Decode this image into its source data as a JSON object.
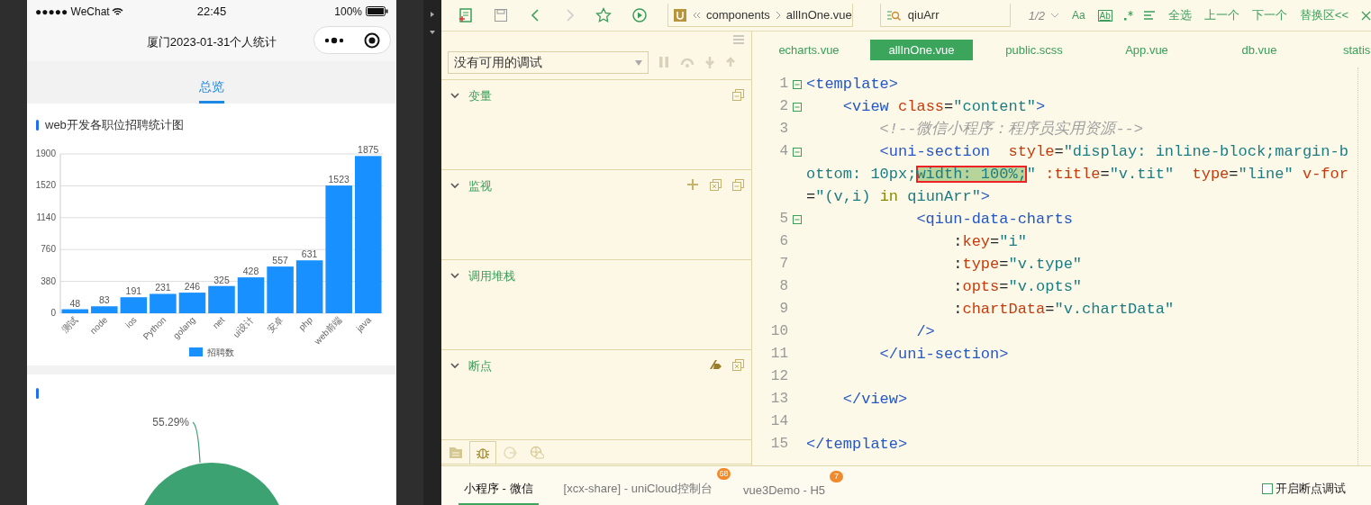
{
  "phone": {
    "status_bar": {
      "carrier": "●●●●● WeChat",
      "time": "22:45",
      "battery": "100%"
    },
    "title": "厦门2023-01-31个人统计",
    "tabs": [
      {
        "label": "总览",
        "selected": true
      }
    ],
    "sections": [
      {
        "kind": "bar",
        "title": "web开发各职位招聘统计图",
        "chart_data": {
          "type": "bar",
          "categories": [
            "测试",
            "node",
            "ios",
            "Python",
            "golang",
            "net",
            "ui设计",
            "安卓",
            "php",
            "web前端",
            "java"
          ],
          "series": [
            {
              "name": "招聘数",
              "color": "#1890ff",
              "values": [
                48,
                83,
                191,
                231,
                246,
                325,
                428,
                557,
                631,
                1523,
                1875
              ]
            }
          ],
          "ylim": [
            0,
            1900
          ],
          "yticks": [
            0,
            380,
            760,
            1140,
            1520,
            1900
          ],
          "data_labels": true,
          "grid": true
        }
      },
      {
        "kind": "pie",
        "pie_label": "55.29%"
      }
    ]
  },
  "toolbar": {
    "forward_disabled": true,
    "breadcrumb": [
      "components",
      "allInOne.vue"
    ],
    "search": {
      "value": "qiuArr",
      "count": "1/2"
    },
    "find_options": [
      "Aa",
      "Ab"
    ],
    "actions": [
      "全选",
      "上一个",
      "下一个",
      "替换区<<"
    ]
  },
  "debug": {
    "target": "没有可用的调试",
    "controls_disabled": true,
    "sections": [
      {
        "title": "变量",
        "expanded": true
      },
      {
        "title": "监视",
        "expanded": true
      },
      {
        "title": "调用堆栈",
        "expanded": true
      },
      {
        "title": "断点",
        "expanded": true
      }
    ],
    "side_tabs": [
      {
        "selected": false
      },
      {
        "selected": true
      },
      {
        "selected": false
      },
      {
        "selected": false
      }
    ]
  },
  "editor": {
    "tabs": [
      {
        "label": "echarts.vue",
        "selected": false
      },
      {
        "label": "allInOne.vue",
        "selected": true
      },
      {
        "label": "public.scss",
        "selected": false
      },
      {
        "label": "App.vue",
        "selected": false
      },
      {
        "label": "db.vue",
        "selected": false
      },
      {
        "label": "statis",
        "selected": false
      }
    ],
    "lines": [
      {
        "number": "1",
        "fold": true,
        "wraps": [
          {
            "tokens": [
              {
                "kind": "tag",
                "text": "<template>"
              }
            ]
          }
        ]
      },
      {
        "number": "2",
        "fold": true,
        "wraps": [
          {
            "tokens": [
              {
                "kind": "tag",
                "text": "    <view "
              },
              {
                "kind": "attr",
                "text": "class"
              },
              {
                "kind": "plain",
                "text": "="
              },
              {
                "kind": "string",
                "text": "\"content\""
              },
              {
                "kind": "tag",
                "text": ">"
              }
            ]
          }
        ]
      },
      {
        "number": "3",
        "fold": false,
        "wraps": [
          {
            "tokens": [
              {
                "kind": "comment",
                "text": "        <!--微信小程序：程序员实用资源-->"
              }
            ]
          }
        ]
      },
      {
        "number": "4",
        "fold": true,
        "wraps": [
          {
            "tokens": [
              {
                "kind": "tag",
                "text": "        <uni-section  "
              },
              {
                "kind": "attr",
                "text": "style"
              },
              {
                "kind": "plain",
                "text": "="
              },
              {
                "kind": "string",
                "text": "\"display: inline-block;margin-b"
              }
            ]
          },
          {
            "tokens": [
              {
                "kind": "string",
                "text": "ottom: 10px;"
              },
              {
                "kind": "selection",
                "text": "width: 100%;"
              },
              {
                "kind": "string",
                "text": "\" "
              },
              {
                "kind": "attr",
                "text": ":title"
              },
              {
                "kind": "plain",
                "text": "="
              },
              {
                "kind": "string",
                "text": "\"v.tit\"  "
              },
              {
                "kind": "attr",
                "text": "type"
              },
              {
                "kind": "plain",
                "text": "="
              },
              {
                "kind": "string",
                "text": "\"line\" "
              },
              {
                "kind": "attr",
                "text": "v-for"
              }
            ]
          },
          {
            "tokens": [
              {
                "kind": "plain",
                "text": "="
              },
              {
                "kind": "string",
                "text": "\"(v,i) "
              },
              {
                "kind": "keyword",
                "text": "in"
              },
              {
                "kind": "string",
                "text": " qiunArr\""
              },
              {
                "kind": "tag",
                "text": ">"
              }
            ]
          }
        ]
      },
      {
        "number": "5",
        "fold": true,
        "wraps": [
          {
            "tokens": [
              {
                "kind": "tag",
                "text": "            <qiun-data-charts"
              }
            ]
          }
        ]
      },
      {
        "number": "6",
        "fold": false,
        "wraps": [
          {
            "tokens": [
              {
                "kind": "plain",
                "text": "                :"
              },
              {
                "kind": "attr",
                "text": "key"
              },
              {
                "kind": "plain",
                "text": "="
              },
              {
                "kind": "string",
                "text": "\"i\""
              }
            ]
          }
        ]
      },
      {
        "number": "7",
        "fold": false,
        "wraps": [
          {
            "tokens": [
              {
                "kind": "plain",
                "text": "                :"
              },
              {
                "kind": "attr",
                "text": "type"
              },
              {
                "kind": "plain",
                "text": "="
              },
              {
                "kind": "string",
                "text": "\"v.type\""
              }
            ]
          }
        ]
      },
      {
        "number": "8",
        "fold": false,
        "wraps": [
          {
            "tokens": [
              {
                "kind": "plain",
                "text": "                :"
              },
              {
                "kind": "attr",
                "text": "opts"
              },
              {
                "kind": "plain",
                "text": "="
              },
              {
                "kind": "string",
                "text": "\"v.opts\""
              }
            ]
          }
        ]
      },
      {
        "number": "9",
        "fold": false,
        "wraps": [
          {
            "tokens": [
              {
                "kind": "plain",
                "text": "                :"
              },
              {
                "kind": "attr",
                "text": "chartData"
              },
              {
                "kind": "plain",
                "text": "="
              },
              {
                "kind": "string",
                "text": "\"v.chartData\""
              }
            ]
          }
        ]
      },
      {
        "number": "10",
        "fold": false,
        "wraps": [
          {
            "tokens": [
              {
                "kind": "tag",
                "text": "            />"
              }
            ]
          }
        ]
      },
      {
        "number": "11",
        "fold": false,
        "wraps": [
          {
            "tokens": [
              {
                "kind": "tag",
                "text": "        </uni-section>"
              }
            ]
          }
        ]
      },
      {
        "number": "12",
        "fold": false
      },
      {
        "number": "13",
        "fold": false,
        "wraps": [
          {
            "tokens": [
              {
                "kind": "tag",
                "text": "    </view>"
              }
            ]
          }
        ]
      },
      {
        "number": "14",
        "fold": false
      },
      {
        "number": "15",
        "fold": false,
        "wraps": [
          {
            "tokens": [
              {
                "kind": "tag",
                "text": "</template>"
              }
            ]
          }
        ]
      }
    ]
  },
  "bottom": {
    "tabs": [
      {
        "label": "小程序 - 微信",
        "selected": true
      },
      {
        "label": "[xcx-share] - uniCloud控制台",
        "selected": false,
        "badge": "68"
      },
      {
        "label": "vue3Demo - H5",
        "selected": false,
        "badge": "7"
      }
    ],
    "breakpoint_toggle": {
      "label": "开启断点调试",
      "checked": false
    }
  }
}
